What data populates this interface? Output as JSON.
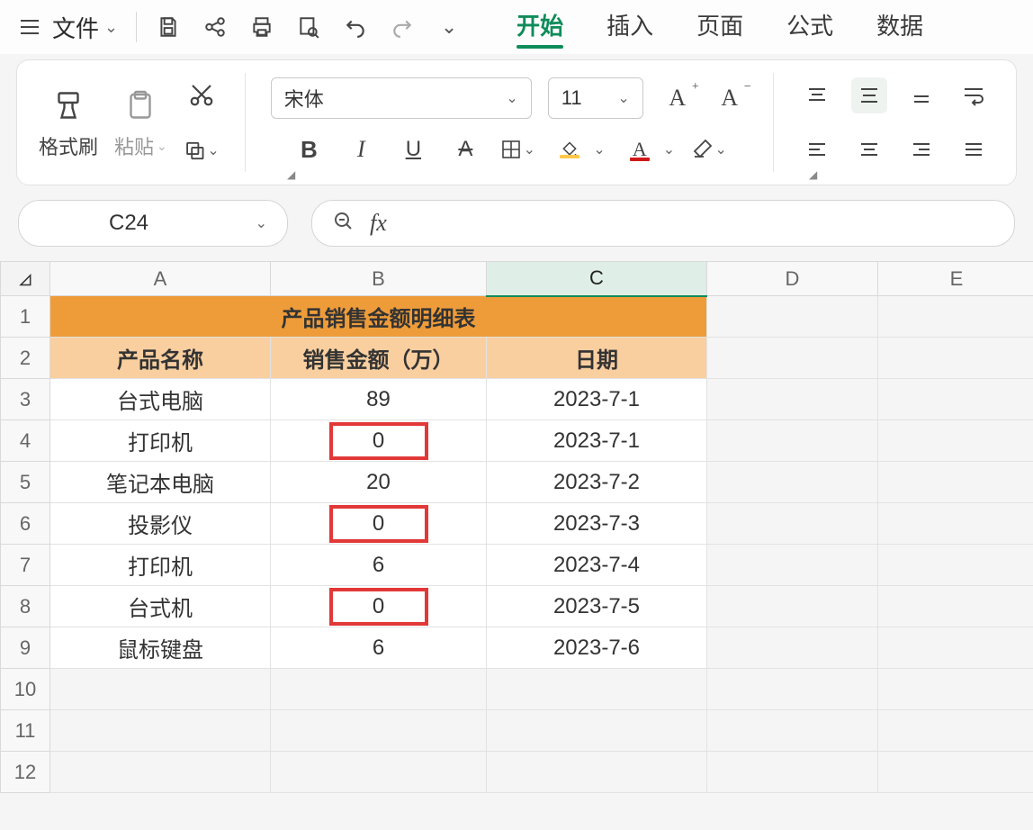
{
  "menubar": {
    "file_label": "文件"
  },
  "tabs": {
    "start": "开始",
    "insert": "插入",
    "page": "页面",
    "formula": "公式",
    "data": "数据"
  },
  "ribbon": {
    "format_painter": "格式刷",
    "paste": "粘贴",
    "font_name": "宋体",
    "font_size": "11"
  },
  "namebox": {
    "value": "C24",
    "fx": "fx"
  },
  "columns": [
    "A",
    "B",
    "C",
    "D",
    "E"
  ],
  "row_numbers": [
    "1",
    "2",
    "3",
    "4",
    "5",
    "6",
    "7",
    "8",
    "9",
    "10",
    "11",
    "12"
  ],
  "table": {
    "title": "产品销售金额明细表",
    "headers": [
      "产品名称",
      "销售金额（万）",
      "日期"
    ],
    "rows": [
      {
        "name": "台式电脑",
        "amount": "89",
        "date": "2023-7-1",
        "highlight": false
      },
      {
        "name": "打印机",
        "amount": "0",
        "date": "2023-7-1",
        "highlight": true
      },
      {
        "name": "笔记本电脑",
        "amount": "20",
        "date": "2023-7-2",
        "highlight": false
      },
      {
        "name": "投影仪",
        "amount": "0",
        "date": "2023-7-3",
        "highlight": true
      },
      {
        "name": "打印机",
        "amount": "6",
        "date": "2023-7-4",
        "highlight": false
      },
      {
        "name": "台式机",
        "amount": "0",
        "date": "2023-7-5",
        "highlight": true
      },
      {
        "name": "鼠标键盘",
        "amount": "6",
        "date": "2023-7-6",
        "highlight": false
      }
    ]
  },
  "colors": {
    "accent": "#0f8c5a",
    "title_bg": "#ee9c3a",
    "header_bg": "#f9cfa0",
    "highlight_border": "#e23838"
  }
}
